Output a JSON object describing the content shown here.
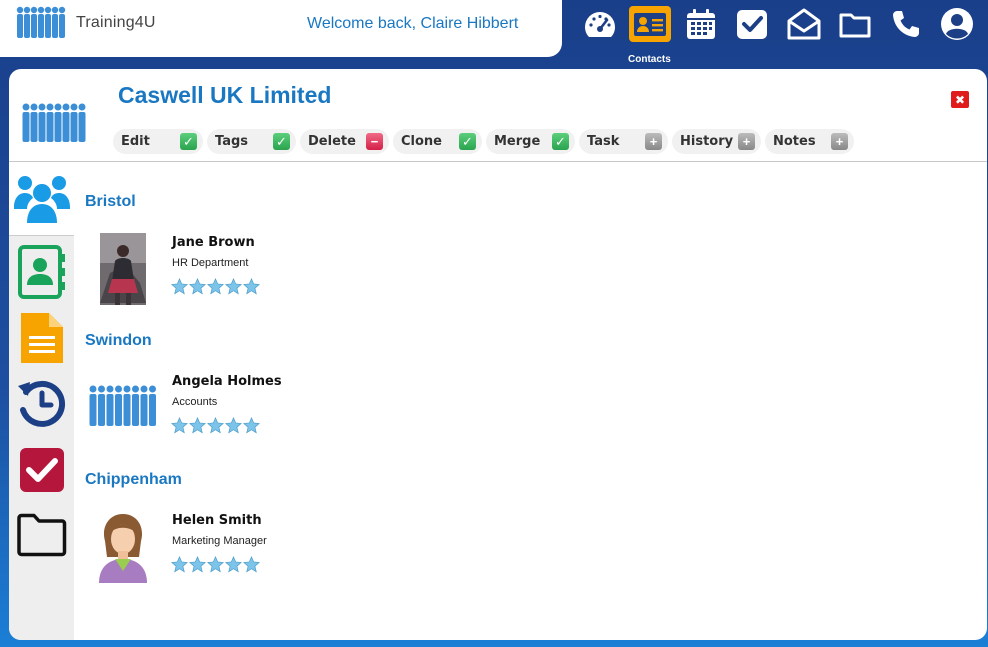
{
  "header": {
    "logo_text": "Training4U",
    "welcome": "Welcome back, Claire Hibbert"
  },
  "nav": {
    "items": [
      {
        "name": "dashboard",
        "icon": "speedometer-icon"
      },
      {
        "name": "contacts",
        "icon": "contact-card-icon",
        "active": true
      },
      {
        "name": "calendar",
        "icon": "calendar-icon"
      },
      {
        "name": "tasks",
        "icon": "checkbox-icon"
      },
      {
        "name": "mail",
        "icon": "envelope-icon"
      },
      {
        "name": "files",
        "icon": "folder-icon"
      },
      {
        "name": "phone",
        "icon": "phone-icon"
      },
      {
        "name": "account",
        "icon": "user-circle-icon"
      }
    ],
    "active_label": "Contacts"
  },
  "company": {
    "title": "Caswell UK Limited"
  },
  "toolbar": {
    "items": [
      {
        "label": "Edit",
        "badge": "check"
      },
      {
        "label": "Tags",
        "badge": "check"
      },
      {
        "label": "Delete",
        "badge": "minus"
      },
      {
        "label": "Clone",
        "badge": "check"
      },
      {
        "label": "Merge",
        "badge": "check"
      },
      {
        "label": "Task",
        "badge": "plus"
      },
      {
        "label": "History",
        "badge": "plus"
      },
      {
        "label": "Notes",
        "badge": "plus"
      }
    ]
  },
  "sidebar": {
    "items": [
      {
        "icon": "people-icon",
        "active": true
      },
      {
        "icon": "address-book-icon"
      },
      {
        "icon": "document-icon"
      },
      {
        "icon": "history-icon"
      },
      {
        "icon": "task-check-icon"
      },
      {
        "icon": "folder-icon"
      }
    ]
  },
  "groups": [
    {
      "location": "Bristol",
      "contacts": [
        {
          "name": "Jane Brown",
          "department": "HR Department",
          "rating": 5,
          "photo": "photo"
        }
      ]
    },
    {
      "location": "Swindon",
      "contacts": [
        {
          "name": "Angela Holmes",
          "department": "Accounts",
          "rating": 5,
          "photo": "group"
        }
      ]
    },
    {
      "location": "Chippenham",
      "contacts": [
        {
          "name": "Helen Smith",
          "department": "Marketing Manager",
          "rating": 5,
          "photo": "avatar"
        }
      ]
    }
  ],
  "colors": {
    "brand_blue": "#1a78c2",
    "nav_bg": "#1a3f8a",
    "active_nav": "#f7a400",
    "star": "#7cc4ea"
  }
}
